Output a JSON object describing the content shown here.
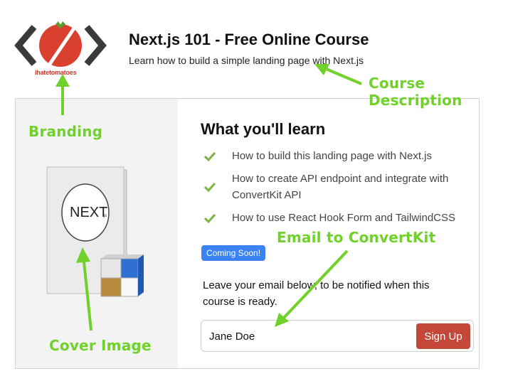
{
  "branding": {
    "logo_icon": "tomato-code-brackets-logo",
    "brand_name": "ihatetomatoes",
    "colors": {
      "tomato": "#d9402e",
      "brackets": "#3a3a3a",
      "leaf": "#5aa02c"
    }
  },
  "header": {
    "title": "Next.js 101 - Free Online Course",
    "subtitle": "Learn how to build a simple landing page with Next.js"
  },
  "course_card": {
    "cover": {
      "label": "NEXT.js",
      "icon": "book-cover-with-cube-icon"
    },
    "learn_title": "What you'll learn",
    "learn_items": [
      "How to build this landing page with Next.js",
      "How to create API endpoint and integrate with ConvertKit API",
      "How to use React Hook Form and TailwindCSS"
    ],
    "badge": "Coming Soon!",
    "notify_text": "Leave your email below, to be notified when this course is ready.",
    "email_value": "Jane Doe",
    "signup_label": "Sign Up",
    "colors": {
      "check": "#7cb342",
      "badge": "#3b82f6",
      "button": "#c4473a"
    }
  },
  "annotations": {
    "branding": "Branding",
    "course_description": "Course Description",
    "email_to_convertkit": "Email to ConvertKit",
    "cover_image": "Cover Image",
    "color": "#6fd12a"
  }
}
